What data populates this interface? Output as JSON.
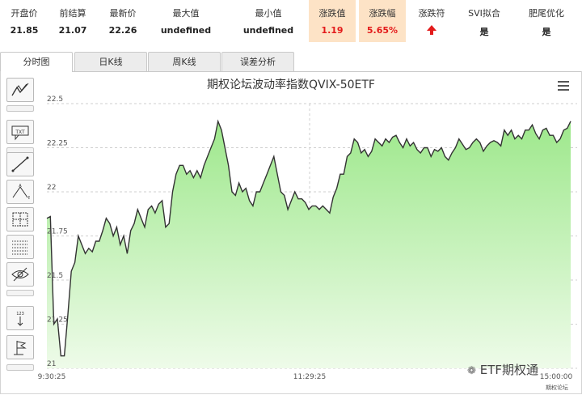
{
  "stats": [
    {
      "label": "开盘价",
      "value": "21.85"
    },
    {
      "label": "前结算",
      "value": "21.07"
    },
    {
      "label": "最新价",
      "value": "22.26"
    },
    {
      "label": "最大值",
      "value": "undefined"
    },
    {
      "label": "最小值",
      "value": "undefined"
    },
    {
      "label": "涨跌值",
      "value": "1.19"
    },
    {
      "label": "涨跌幅",
      "value": "5.65%"
    },
    {
      "label": "涨跌符",
      "value": ""
    },
    {
      "label": "SVI拟合",
      "value": "是"
    },
    {
      "label": "肥尾优化",
      "value": "是"
    }
  ],
  "colors": {
    "highlight": "#fde3c6",
    "up": "#e31b1b",
    "area": "#9ee88c",
    "line": "#333333"
  },
  "tabs": [
    {
      "label": "分时图",
      "active": true
    },
    {
      "label": "日K线",
      "active": false
    },
    {
      "label": "周K线",
      "active": false
    },
    {
      "label": "误差分析",
      "active": false
    }
  ],
  "toolbar_icons": [
    "trend-lines-icon",
    "text-label-icon",
    "line-segment-icon",
    "fibonacci-icon",
    "measure-icon",
    "horizontal-lines-icon",
    "hide-eye-icon",
    "numbering-icon",
    "flag-icon"
  ],
  "chart_data": {
    "type": "area",
    "title": "期权论坛波动率指数QVIX-50ETF",
    "ylim": [
      21,
      22.5
    ],
    "yticks": [
      "22.5",
      "22.25",
      "22",
      "21.75",
      "21.5",
      "21.25",
      "21"
    ],
    "xticks": [
      "9:30:25",
      "11:29:25",
      "15:00:00"
    ],
    "x_index_range": [
      0,
      100
    ],
    "series": [
      {
        "values": [
          21.85,
          21.86,
          21.25,
          21.28,
          21.07,
          21.07,
          21.3,
          21.55,
          21.6,
          21.75,
          21.7,
          21.65,
          21.68,
          21.66,
          21.72,
          21.72,
          21.78,
          21.85,
          21.82,
          21.75,
          21.8,
          21.7,
          21.75,
          21.65,
          21.78,
          21.82,
          21.9,
          21.85,
          21.8,
          21.9,
          21.92,
          21.88,
          21.93,
          21.95,
          21.8,
          21.82,
          22.0,
          22.1,
          22.15,
          22.15,
          22.1,
          22.12,
          22.08,
          22.12,
          22.08,
          22.15,
          22.2,
          22.25,
          22.3,
          22.4,
          22.35,
          22.25,
          22.15,
          22.0,
          21.98,
          22.05,
          22.0,
          22.02,
          21.95,
          21.92,
          22.0,
          22.0,
          22.05,
          22.1,
          22.15,
          22.2,
          22.1,
          22.0,
          21.98,
          21.9,
          21.95,
          22.0,
          21.96,
          21.96,
          21.94,
          21.9,
          21.92,
          21.92,
          21.9,
          21.92,
          21.9,
          21.88,
          21.97,
          22.02,
          22.1,
          22.1,
          22.2,
          22.22,
          22.3,
          22.28,
          22.22,
          22.24,
          22.2,
          22.23,
          22.3,
          22.28,
          22.26,
          22.3,
          22.28,
          22.31,
          22.32,
          22.28,
          22.25,
          22.3,
          22.26,
          22.28,
          22.24,
          22.22,
          22.25,
          22.25,
          22.2,
          22.24,
          22.23,
          22.25,
          22.2,
          22.18,
          22.22,
          22.25,
          22.3,
          22.27,
          22.24,
          22.25,
          22.28,
          22.3,
          22.28,
          22.23,
          22.26,
          22.28,
          22.29,
          22.28,
          22.26,
          22.35,
          22.32,
          22.35,
          22.3,
          22.32,
          22.3,
          22.35,
          22.35,
          22.38,
          22.33,
          22.3,
          22.35,
          22.36,
          22.32,
          22.32,
          22.28,
          22.3,
          22.35,
          22.36,
          22.4
        ]
      }
    ]
  },
  "watermark": {
    "brand": "ETF期权通",
    "small": "期权论坛"
  }
}
